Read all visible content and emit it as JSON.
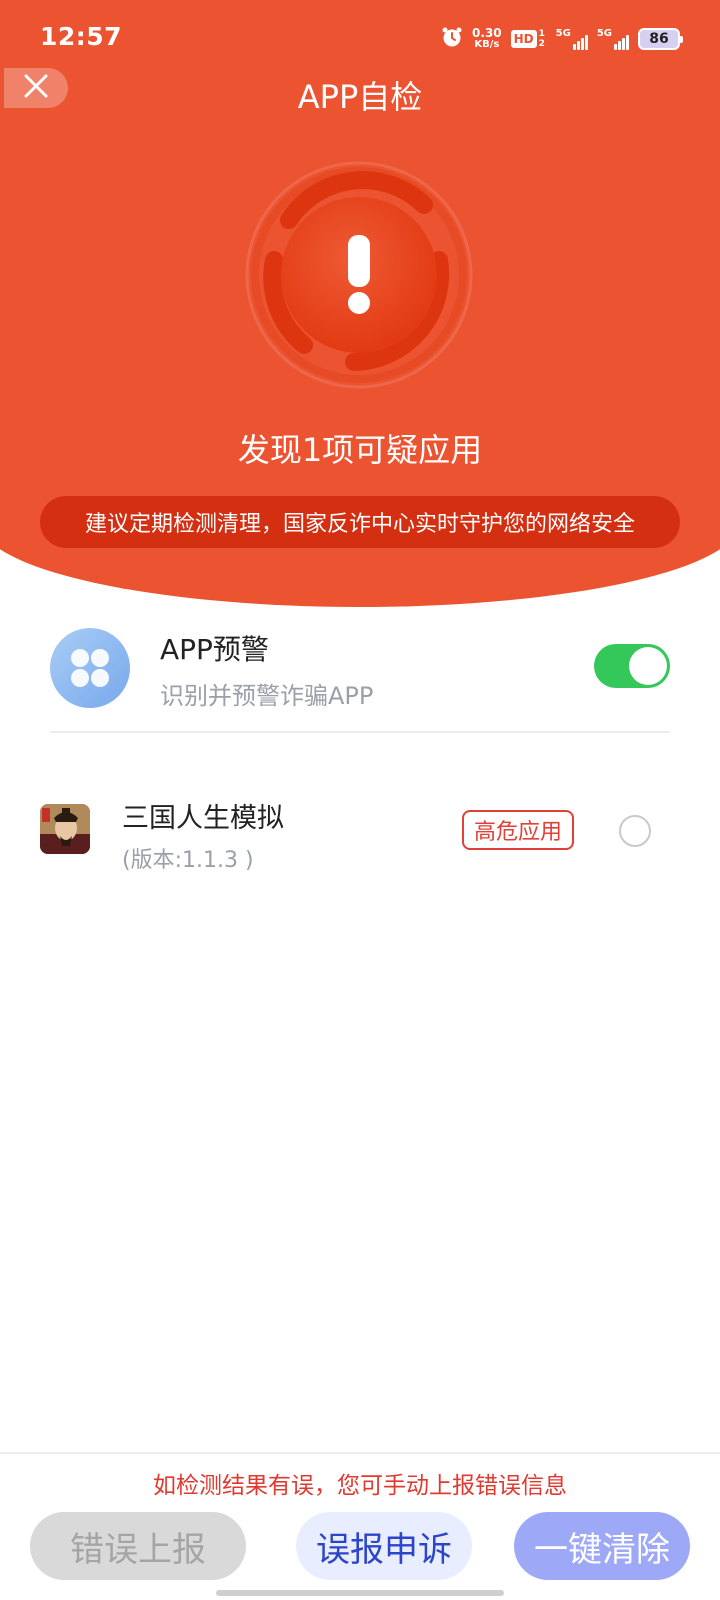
{
  "status_bar": {
    "time": "12:57",
    "net_speed_value": "0.30",
    "net_speed_unit": "KB/s",
    "hd_label": "HD",
    "hd_sub": "1 2",
    "signal1_label": "5G",
    "signal2_label": "5G",
    "battery": "86",
    "icons": [
      "alarm-icon",
      "hd-icon",
      "signal-icon",
      "signal-icon",
      "battery-icon"
    ]
  },
  "header": {
    "title": "APP自检",
    "close_icon": "close-icon"
  },
  "scan_result": {
    "icon": "alert-icon",
    "headline": "发现1项可疑应用",
    "tip": "建议定期检测清理，国家反诈中心实时守护您的网络安全"
  },
  "app_warning": {
    "icon": "app-grid-icon",
    "title": "APP预警",
    "subtitle": "识别并预警诈骗APP",
    "enabled": true
  },
  "suspicious_apps": [
    {
      "name": "三国人生模拟",
      "version": "(版本:1.1.3 )",
      "risk_label": "高危应用",
      "selected": false
    }
  ],
  "footer": {
    "note": "如检测结果有误，您可手动上报错误信息",
    "report_label": "错误上报",
    "appeal_label": "误报申诉",
    "clean_label": "一键清除"
  },
  "colors": {
    "primary_red": "#ec5331",
    "tip_red": "#d52f12",
    "risk_red": "#e14036",
    "toggle_green": "#34c759",
    "appeal_blue": "#2c45c9",
    "clean_purple": "#9da9f6"
  }
}
